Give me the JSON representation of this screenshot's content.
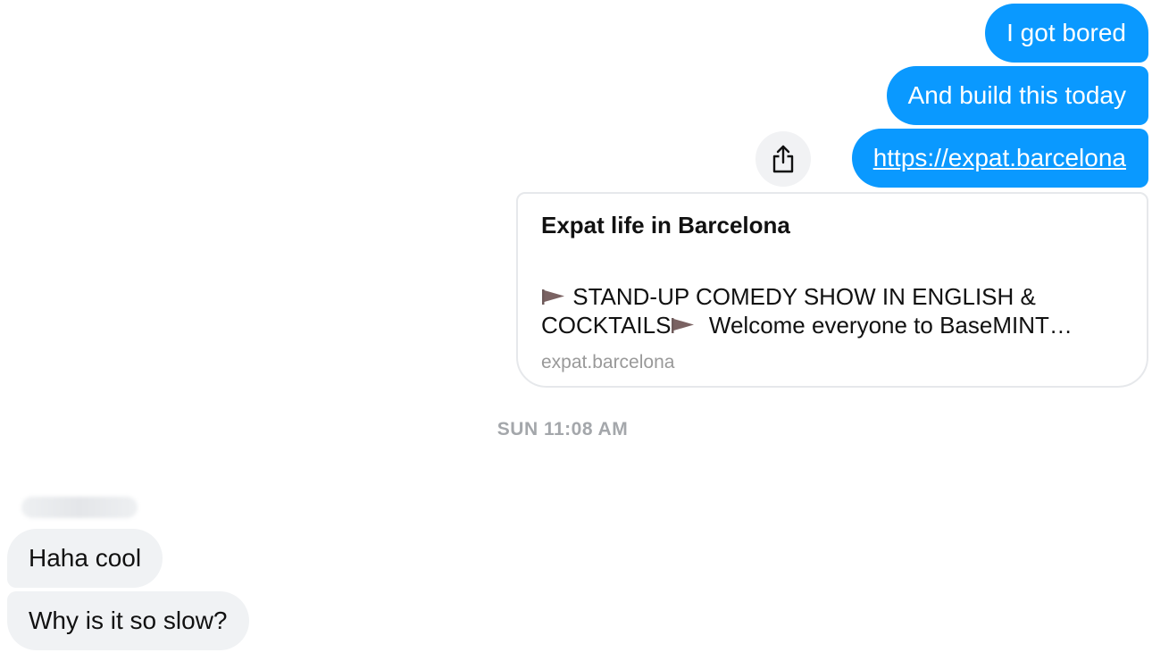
{
  "conversation": {
    "outgoing": [
      {
        "text": "I got bored"
      },
      {
        "text": "And build this today"
      },
      {
        "text": "https://expat.barcelona"
      }
    ],
    "link_preview": {
      "title": "Expat life in Barcelona",
      "description_line1": " STAND-UP COMEDY SHOW IN ENGLISH &",
      "description_line2_a": "COCKTAILS",
      "description_line2_b": "  Welcome everyone to BaseMINT…",
      "domain": "expat.barcelona",
      "description_icon": "triangular-flag"
    },
    "timestamp": "SUN 11:08 AM",
    "incoming_sender": " ",
    "incoming": [
      {
        "text": "Haha cool"
      },
      {
        "text": "Why is it so slow?"
      }
    ]
  },
  "share_button": {
    "icon": "share-icon"
  },
  "colors": {
    "outgoing_bubble": "#0a99ff",
    "incoming_bubble": "#f0f2f4",
    "timestamp": "#a4a7ab",
    "domain_text": "#999999"
  }
}
